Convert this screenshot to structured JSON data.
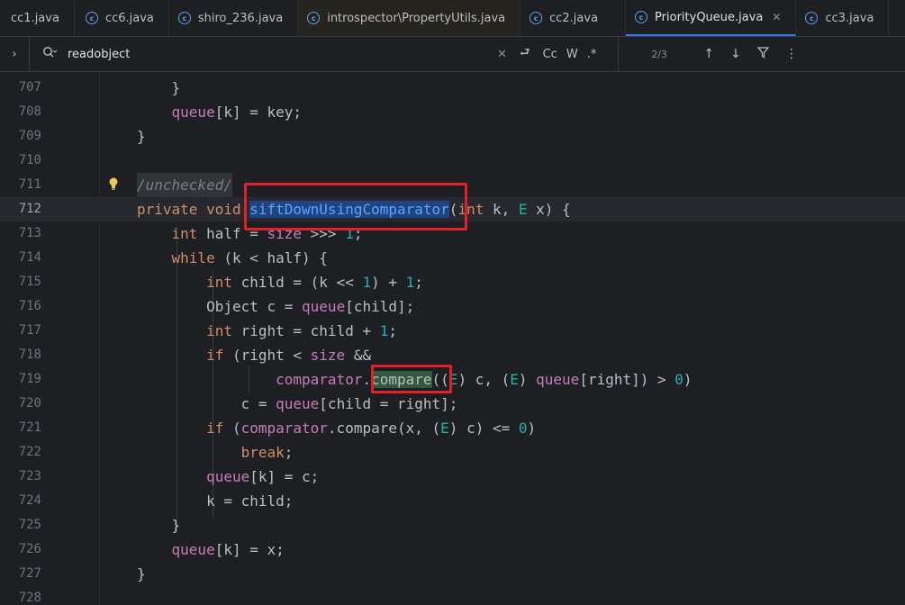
{
  "tabs": [
    {
      "label": "cc1.java",
      "active": false,
      "has_icon": false
    },
    {
      "label": "cc6.java",
      "active": false,
      "has_icon": true
    },
    {
      "label": "shiro_236.java",
      "active": false,
      "has_icon": true
    },
    {
      "label": "introspector\\PropertyUtils.java",
      "active": false,
      "has_icon": true
    },
    {
      "label": "cc2.java",
      "active": false,
      "has_icon": true
    },
    {
      "label": "PriorityQueue.java",
      "active": true,
      "has_icon": true
    },
    {
      "label": "cc3.java",
      "active": false,
      "has_icon": true
    }
  ],
  "find": {
    "query": "readobject",
    "match_case_label": "Cc",
    "words_label": "W",
    "regex_label": ".*",
    "result_count": "2/3"
  },
  "icons": {
    "expand": "chevron-right-icon",
    "search": "search-history-icon",
    "clear": "close-icon",
    "replace": "new-line-icon",
    "prev": "arrow-up-icon",
    "next": "arrow-down-icon",
    "filter": "filter-icon",
    "more": "more-vertical-icon",
    "bulb": "lightbulb-icon"
  },
  "colors": {
    "keyword": "#cf8e6d",
    "field": "#c77dbb",
    "number": "#2aacb8",
    "type_param": "#16baac",
    "function": "#56a8f5",
    "annotation_box": "#e3202a"
  },
  "lines": [
    {
      "n": "707",
      "text": "        }"
    },
    {
      "n": "708",
      "text": "        queue[k] = key;"
    },
    {
      "n": "709",
      "text": "    }"
    },
    {
      "n": "710",
      "text": ""
    },
    {
      "n": "711",
      "text": "    /unchecked/"
    },
    {
      "n": "712",
      "text": "    private void siftDownUsingComparator(int k, E x) {"
    },
    {
      "n": "713",
      "text": "        int half = size >>> 1;"
    },
    {
      "n": "714",
      "text": "        while (k < half) {"
    },
    {
      "n": "715",
      "text": "            int child = (k << 1) + 1;"
    },
    {
      "n": "716",
      "text": "            Object c = queue[child];"
    },
    {
      "n": "717",
      "text": "            int right = child + 1;"
    },
    {
      "n": "718",
      "text": "            if (right < size &&"
    },
    {
      "n": "719",
      "text": "                comparator.compare((E) c, (E) queue[right]) > 0)"
    },
    {
      "n": "720",
      "text": "                c = queue[child = right];"
    },
    {
      "n": "721",
      "text": "            if (comparator.compare(x, (E) c) <= 0)"
    },
    {
      "n": "722",
      "text": "                break;"
    },
    {
      "n": "723",
      "text": "            queue[k] = c;"
    },
    {
      "n": "724",
      "text": "            k = child;"
    },
    {
      "n": "725",
      "text": "        }"
    },
    {
      "n": "726",
      "text": "        queue[k] = x;"
    },
    {
      "n": "727",
      "text": "    }"
    },
    {
      "n": "728",
      "text": ""
    }
  ]
}
